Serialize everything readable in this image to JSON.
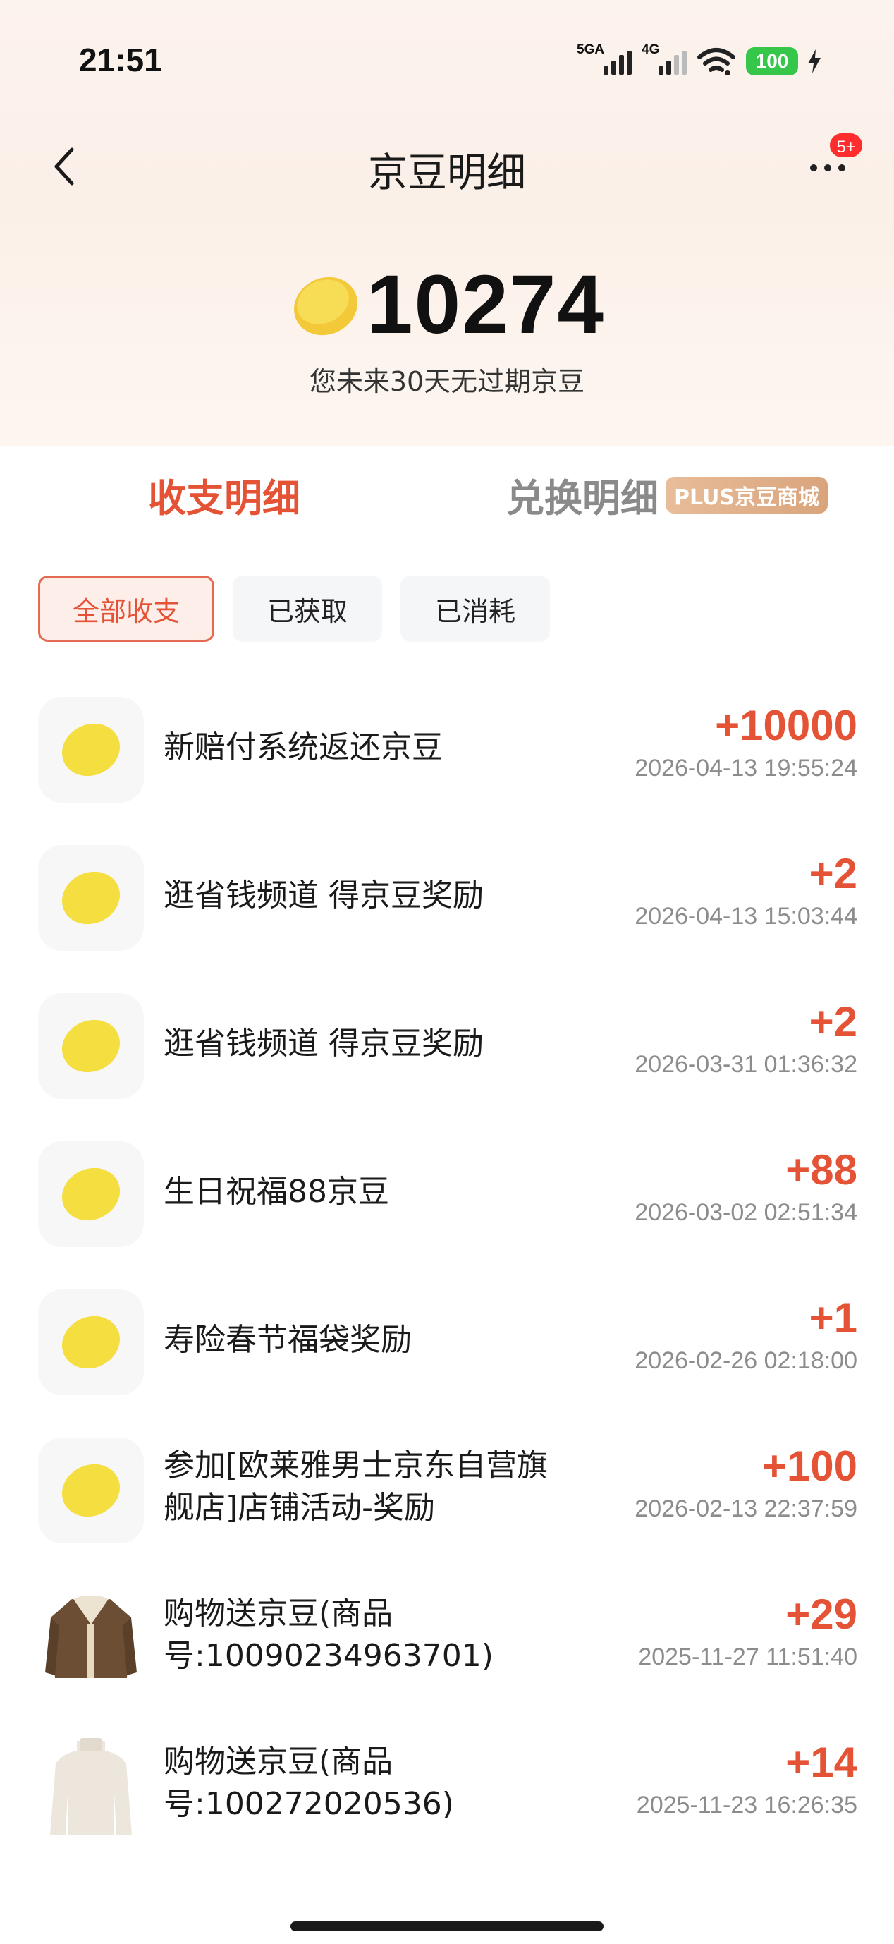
{
  "status_bar": {
    "time": "21:51",
    "sim1": "5GA",
    "sim2": "4G",
    "battery": "100"
  },
  "header": {
    "title": "京豆明细",
    "badge": "5+"
  },
  "balance": {
    "value": "10274",
    "note": "您未来30天无过期京豆"
  },
  "tabs": {
    "income": "收支明细",
    "exchange": "兑换明细",
    "plus_tag": "PLUS京豆商城"
  },
  "filters": {
    "all": "全部收支",
    "obtained": "已获取",
    "consumed": "已消耗"
  },
  "items": [
    {
      "title": "新赔付系统返还京豆",
      "amount": "+10000",
      "time": "2026-04-13 19:55:24",
      "icon": "bean-icon"
    },
    {
      "title": "逛省钱频道 得京豆奖励",
      "amount": "+2",
      "time": "2026-04-13 15:03:44",
      "icon": "bean-icon"
    },
    {
      "title": "逛省钱频道 得京豆奖励",
      "amount": "+2",
      "time": "2026-03-31 01:36:32",
      "icon": "bean-icon"
    },
    {
      "title": "生日祝福88京豆",
      "amount": "+88",
      "time": "2026-03-02 02:51:34",
      "icon": "bean-icon"
    },
    {
      "title": "寿险春节福袋奖励",
      "amount": "+1",
      "time": "2026-02-26 02:18:00",
      "icon": "bean-icon"
    },
    {
      "title": "参加[欧莱雅男士京东自营旗舰店]店铺活动-奖励",
      "amount": "+100",
      "time": "2026-02-13 22:37:59",
      "icon": "bean-icon"
    },
    {
      "title": "购物送京豆(商品号:10090234963701)",
      "amount": "+29",
      "time": "2025-11-27 11:51:40",
      "icon": "jacket-product-image"
    },
    {
      "title": "购物送京豆(商品号:100272020536)",
      "amount": "+14",
      "time": "2025-11-23 16:26:35",
      "icon": "sweater-product-image"
    }
  ],
  "colors": {
    "accent": "#e55336",
    "bean": "#f5d936",
    "hero_bg": "#fbf0e8"
  }
}
